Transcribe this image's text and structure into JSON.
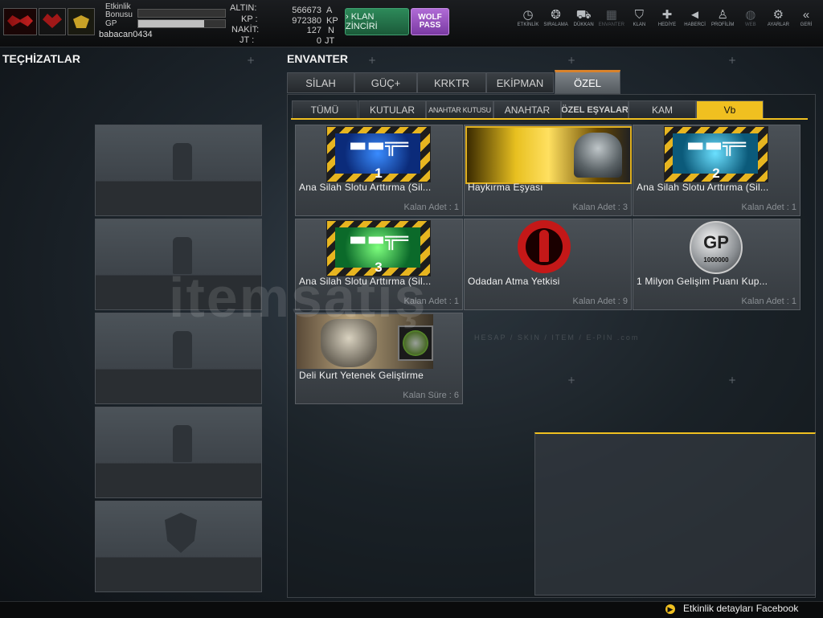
{
  "profile": {
    "etkinlik_label": "Etkinlik Bonusu",
    "gp_label": "GP",
    "username": "babacan0434",
    "etkinlik_progress": 0,
    "gp_progress": 0.76
  },
  "currency": [
    {
      "label": "ALTIN:",
      "value": "566673",
      "unit": "A"
    },
    {
      "label": "KP :",
      "value": "972380",
      "unit": "KP"
    },
    {
      "label": "NAKİT:",
      "value": "127",
      "unit": "N"
    },
    {
      "label": "JT :",
      "value": "0",
      "unit": "JT"
    }
  ],
  "buttons": {
    "klan_zinciri": "› KLAN ZİNCİRİ",
    "wolf_pass": "WOLF PASS"
  },
  "nav": [
    {
      "label": "ETKİNLİK",
      "icon": "clock-icon",
      "glyph": "◷",
      "enabled": true
    },
    {
      "label": "SIRALAMA",
      "icon": "medal-icon",
      "glyph": "❂",
      "enabled": true
    },
    {
      "label": "DÜKKAN",
      "icon": "cart-icon",
      "glyph": "⛟",
      "enabled": true
    },
    {
      "label": "ENVANTER",
      "icon": "inventory-icon",
      "glyph": "▦",
      "enabled": false
    },
    {
      "label": "KLAN",
      "icon": "shield-icon",
      "glyph": "⛉",
      "enabled": true
    },
    {
      "label": "HEDİYE",
      "icon": "gift-icon",
      "glyph": "✚",
      "enabled": true
    },
    {
      "label": "HABERCİ",
      "icon": "megaphone-icon",
      "glyph": "◄",
      "enabled": true
    },
    {
      "label": "PROFİLİM",
      "icon": "user-icon",
      "glyph": "♙",
      "enabled": true
    },
    {
      "label": "WEB",
      "icon": "globe-icon",
      "glyph": "◍",
      "enabled": false
    },
    {
      "label": "AYARLAR",
      "icon": "gear-icon",
      "glyph": "⚙",
      "enabled": true
    },
    {
      "label": "GERİ",
      "icon": "back-icon",
      "glyph": "«",
      "enabled": true
    }
  ],
  "left_panel": {
    "title": "TEÇHİZATLAR"
  },
  "inventory": {
    "title": "ENVANTER",
    "main_tabs": [
      "SİLAH",
      "GÜÇ+",
      "KRKTR",
      "EKİPMAN",
      "ÖZEL"
    ],
    "active_main_tab": 4,
    "sub_tabs": [
      "TÜMÜ",
      "KUTULAR",
      "ANAHTAR KUTUSU",
      "ANAHTAR",
      "ÖZEL EŞYALAR",
      "KAM",
      "Vb"
    ],
    "active_sub_tab": 6,
    "items": [
      {
        "name": "Ana Silah Slotu Arttırma (Sil...",
        "count": "Kalan Adet : 1",
        "badge": "1"
      },
      {
        "name": "Haykırma Eşyası",
        "count": "Kalan Adet : 3"
      },
      {
        "name": "Ana Silah Slotu Arttırma (Sil...",
        "count": "Kalan Adet : 1",
        "badge": "2"
      },
      {
        "name": "Ana Silah Slotu Arttırma (Sil...",
        "count": "Kalan Adet : 1",
        "badge": "3"
      },
      {
        "name": "Odadan Atma Yetkisi",
        "count": "Kalan Adet : 9"
      },
      {
        "name": "1 Milyon Gelişim Puanı Kup...",
        "count": "Kalan Adet : 1",
        "gp_amount": "1000000",
        "gp_logo": "GP"
      },
      {
        "name": "Deli Kurt Yetenek Geliştirme",
        "count": "Kalan Süre : 6"
      }
    ]
  },
  "ticker": {
    "text": "Etkinlik detayları Facebook"
  },
  "watermark": {
    "text": "itemsatış",
    "sub": "HESAP / SKIN / ITEM / E-PIN  .com"
  },
  "colors": {
    "accent": "#f0c020",
    "tab_highlight": "#d9822b",
    "klan_green": "#2d8a5a",
    "wolf_purple": "#b06bd6"
  }
}
